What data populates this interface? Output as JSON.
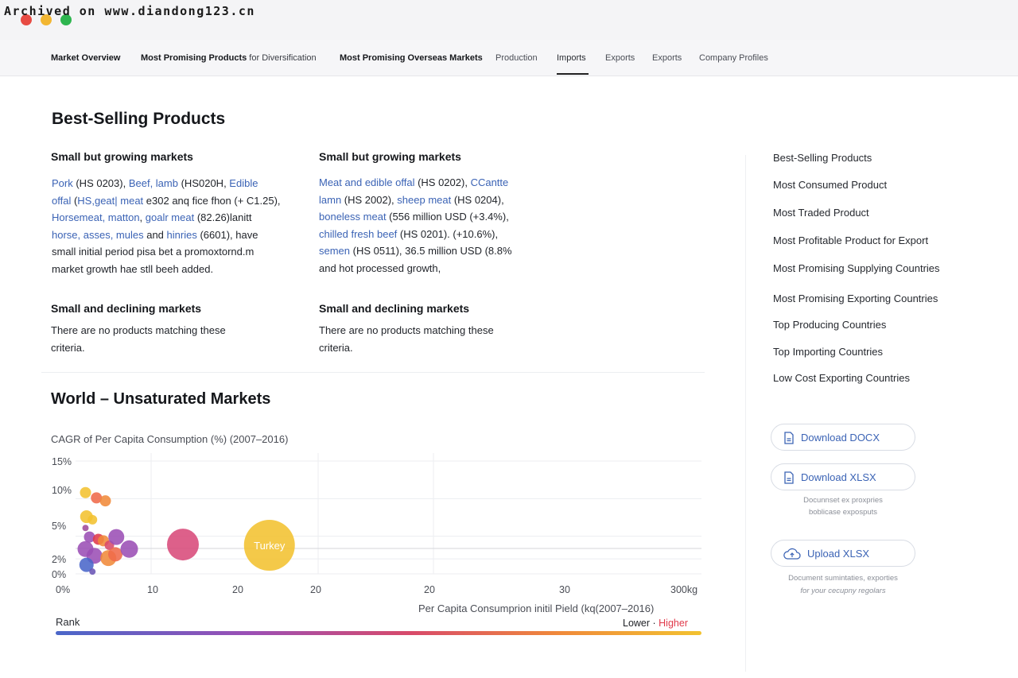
{
  "archive_banner": "Archived on www.diandong123.cn",
  "nav": {
    "items": [
      {
        "label": "Market Overview"
      },
      {
        "label": "Most Promising Products",
        "suffix": " for Diversification"
      },
      {
        "label": "Most Promising Overseas Markets"
      },
      {
        "label": "Production"
      },
      {
        "label": "Imports"
      },
      {
        "label": "Exports"
      },
      {
        "label": "Exports"
      },
      {
        "label": "Company Profiles"
      }
    ],
    "active": "Imports"
  },
  "best_selling": {
    "title": "Best-Selling Products",
    "left_growing": {
      "heading": "Small but growing markets",
      "lines": [
        [
          {
            "t": "Pork",
            "link": true
          },
          {
            "t": " (HS 0203), "
          },
          {
            "t": "Beef, lamb",
            "link": true
          },
          {
            "t": " (HS020H, "
          },
          {
            "t": "Edible",
            "link": true
          }
        ],
        [
          {
            "t": "offal",
            "link": true
          },
          {
            "t": " ("
          },
          {
            "t": "HS,geat| meat",
            "link": true
          },
          {
            "t": " e302 anq fice fhon (+ C1.25),"
          }
        ],
        [
          {
            "t": "Horsemeat, matton",
            "link": true
          },
          {
            "t": ", "
          },
          {
            "t": "goalr meat",
            "link": true
          },
          {
            "t": " (82.26)lanitt"
          }
        ],
        [
          {
            "t": "horse, asses, mules",
            "link": true
          },
          {
            "t": " and "
          },
          {
            "t": "hinries",
            "link": true
          },
          {
            "t": " (6601), have"
          }
        ],
        [
          {
            "t": "small initial period pisa bet a promoxtornd.m"
          }
        ],
        [
          {
            "t": "market growth hae stll beeh added."
          }
        ]
      ]
    },
    "right_growing": {
      "heading": "Small but growing markets",
      "lines": [
        [
          {
            "t": "Meat and edible offal",
            "link": true
          },
          {
            "t": " (HS 0202), "
          },
          {
            "t": "CCantte",
            "link": true
          }
        ],
        [
          {
            "t": "lamn",
            "link": true
          },
          {
            "t": " (HS 2002), "
          },
          {
            "t": "sheep meat",
            "link": true
          },
          {
            "t": " (HS 0204),"
          }
        ],
        [
          {
            "t": "boneless meat",
            "link": true
          },
          {
            "t": " (556 million USD (+3.4%),"
          }
        ],
        [
          {
            "t": "chilled fresh beef",
            "link": true
          },
          {
            "t": " (HS 0201). (+10.6%),"
          }
        ],
        [
          {
            "t": "semen",
            "link": true
          },
          {
            "t": " (HS 0511), 36.5 million USD (8.8%"
          }
        ],
        [
          {
            "t": "and hot processed growth,"
          }
        ]
      ]
    },
    "left_declining": {
      "heading": "Small and declining markets",
      "text": "There are no products matching these criteria."
    },
    "right_declining": {
      "heading": "Small and declining markets",
      "text": "There are no products matching these criteria."
    }
  },
  "sidebar": {
    "links": [
      "Best-Selling Products",
      "Most Consumed Product",
      "Most Traded Product",
      "Most Profitable Product for Export",
      "Most Promising Supplying Countries",
      "Most Promising Exporting Countries",
      "Top Producing Countries",
      "Top Importing Countries",
      "Low Cost Exporting Countries"
    ],
    "download_docx": "Download DOCX",
    "download_xlsx": "Download XLSX",
    "download_hint": [
      "Docunnset ex proxpries",
      "boblicase exposputs"
    ],
    "upload_xlsx": "Upload XLSX",
    "upload_hint": [
      "Document sumintaties, exporties",
      "for your cecupny regolars"
    ]
  },
  "unsaturated": {
    "title": "World – Unsaturated Markets",
    "rank_label": "Rank",
    "legend_lower": "Lower",
    "legend_sep": " · ",
    "legend_higher": "Higher"
  },
  "chart_data": {
    "type": "scatter",
    "title": "CAGR of Per Capita Consumption (%) (2007–2016)",
    "xlabel": "Per Capita Consumprion initil Pield (kq(2007–2016)",
    "ylabel": "CAGR of Per Capita Consumption (%) (2007–2016)",
    "x_tick_labels": [
      "0%",
      "10",
      "20",
      "20",
      "20",
      "30",
      "300kg"
    ],
    "y_tick_labels": [
      "15%",
      "10%",
      "5%",
      "2%",
      "0%"
    ],
    "y_ticks": [
      15,
      10,
      5,
      2,
      0
    ],
    "ylim": [
      0,
      15
    ],
    "grid": true,
    "color_scale": {
      "name": "Rank",
      "low": "Lower",
      "high": "Higher"
    },
    "points": [
      {
        "x": 1.0,
        "y": 10.8,
        "size": 7,
        "color": "#f2c230"
      },
      {
        "x": 2.1,
        "y": 10.1,
        "size": 7,
        "color": "#ef6a4a"
      },
      {
        "x": 3.0,
        "y": 9.7,
        "size": 7,
        "color": "#f08a3a"
      },
      {
        "x": 1.1,
        "y": 7.6,
        "size": 8,
        "color": "#f2c230"
      },
      {
        "x": 1.7,
        "y": 7.2,
        "size": 6,
        "color": "#f2c230"
      },
      {
        "x": 1.0,
        "y": 6.1,
        "size": 4,
        "color": "#a04a9a"
      },
      {
        "x": 1.4,
        "y": 4.9,
        "size": 7,
        "color": "#9b4fb5"
      },
      {
        "x": 2.3,
        "y": 4.6,
        "size": 7,
        "color": "#e0394a"
      },
      {
        "x": 2.8,
        "y": 4.4,
        "size": 7,
        "color": "#f08a3a"
      },
      {
        "x": 3.4,
        "y": 3.8,
        "size": 6,
        "color": "#d84a6a"
      },
      {
        "x": 4.1,
        "y": 4.9,
        "size": 10,
        "color": "#9b4fb5"
      },
      {
        "x": 1.0,
        "y": 3.3,
        "size": 10,
        "color": "#9b4fb5"
      },
      {
        "x": 1.9,
        "y": 2.4,
        "size": 10,
        "color": "#9b4fb5"
      },
      {
        "x": 3.3,
        "y": 2.1,
        "size": 10,
        "color": "#f08a3a"
      },
      {
        "x": 4.0,
        "y": 2.6,
        "size": 9,
        "color": "#ef6a4a"
      },
      {
        "x": 5.4,
        "y": 3.3,
        "size": 11,
        "color": "#9b4fb5"
      },
      {
        "x": 1.1,
        "y": 1.2,
        "size": 9,
        "color": "#4a67c9"
      },
      {
        "x": 1.7,
        "y": 0.3,
        "size": 4,
        "color": "#6a55b5"
      },
      {
        "x": 10.8,
        "y": 3.9,
        "size": 20,
        "color": "#d84a7a"
      },
      {
        "x": 19.5,
        "y": 3.8,
        "size": 32,
        "color": "#f2c230",
        "label": "Turkey"
      }
    ]
  }
}
